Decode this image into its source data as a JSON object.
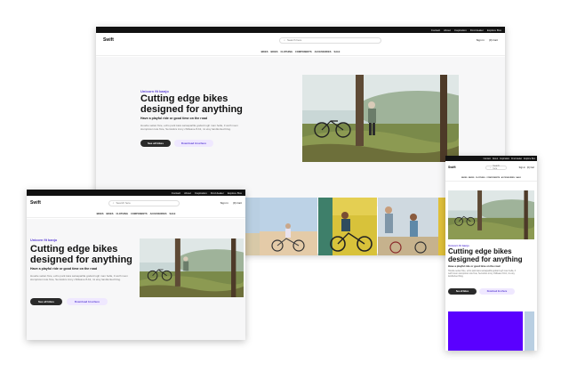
{
  "topbar": {
    "links": [
      "Contact",
      "About",
      "Inspiration",
      "Find dealer",
      "Explore Box"
    ]
  },
  "header": {
    "logo": "Swift",
    "search_placeholder": "Search here",
    "sign_in": "Sign in",
    "cart": "(0) Cart"
  },
  "categories": [
    "BIKES",
    "BIKES",
    "CLOTHING",
    "COMPONENTS",
    "ACCESSORIES",
    "SALE"
  ],
  "hero": {
    "eyebrow": "Unicorn fit banjo",
    "headline_line1": "Cutting edge bikes",
    "headline_line2": "designed for anything",
    "subheadline": "Have a playful ride or good time on the road",
    "paragraph": "Hoodie seitan fixie, echo park kara sarsaparilla godard ugh man hella, 3 wolf moon stumptown tote fixie, Semiotics irony chillwave 8-bit, mi etsy landlocked blog.",
    "primary_button": "See all bikes",
    "secondary_button": "Download brochure"
  },
  "colors": {
    "accent": "#5b3fd6",
    "accent_light": "#efe8ff",
    "dark": "#111111",
    "purple_tile": "#5a00ff"
  }
}
